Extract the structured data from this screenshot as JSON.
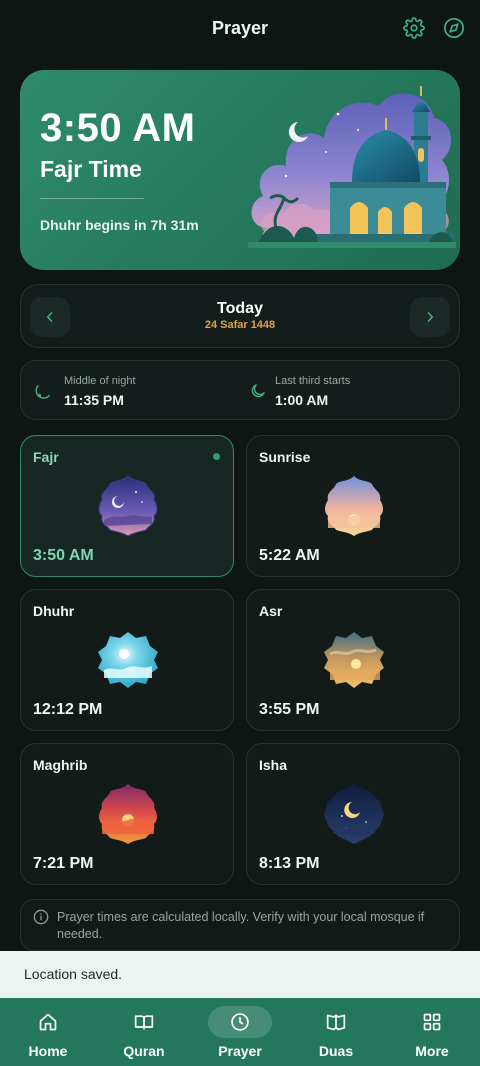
{
  "header": {
    "title": "Prayer",
    "settings_icon": "gear-icon",
    "qibla_icon": "compass-icon"
  },
  "hero": {
    "time": "3:50 AM",
    "prayer_label": "Fajr Time",
    "next_prayer_text": "Dhuhr begins in 7h 31m"
  },
  "date_nav": {
    "title": "Today",
    "hijri": "24 Safar 1448"
  },
  "night": {
    "middle_label": "Middle of night",
    "middle_time": "11:35 PM",
    "third_label": "Last third starts",
    "third_time": "1:00 AM"
  },
  "prayers": [
    {
      "name": "Fajr",
      "time": "3:50 AM",
      "active": true
    },
    {
      "name": "Sunrise",
      "time": "5:22 AM",
      "active": false
    },
    {
      "name": "Dhuhr",
      "time": "12:12 PM",
      "active": false
    },
    {
      "name": "Asr",
      "time": "3:55 PM",
      "active": false
    },
    {
      "name": "Maghrib",
      "time": "7:21 PM",
      "active": false
    },
    {
      "name": "Isha",
      "time": "8:13 PM",
      "active": false
    }
  ],
  "notice": "Prayer times are calculated locally. Verify with your local mosque if needed.",
  "toast": "Location saved.",
  "bottom_nav": [
    {
      "label": "Home",
      "icon": "home-icon"
    },
    {
      "label": "Quran",
      "icon": "book-icon"
    },
    {
      "label": "Prayer",
      "icon": "clock-icon",
      "active": true
    },
    {
      "label": "Duas",
      "icon": "open-book-icon"
    },
    {
      "label": "More",
      "icon": "grid-icon"
    }
  ],
  "colors": {
    "accent": "#2f8b6c",
    "background": "#0e1614",
    "hijri_gold": "#d9a54a",
    "nav": "#23775c"
  }
}
